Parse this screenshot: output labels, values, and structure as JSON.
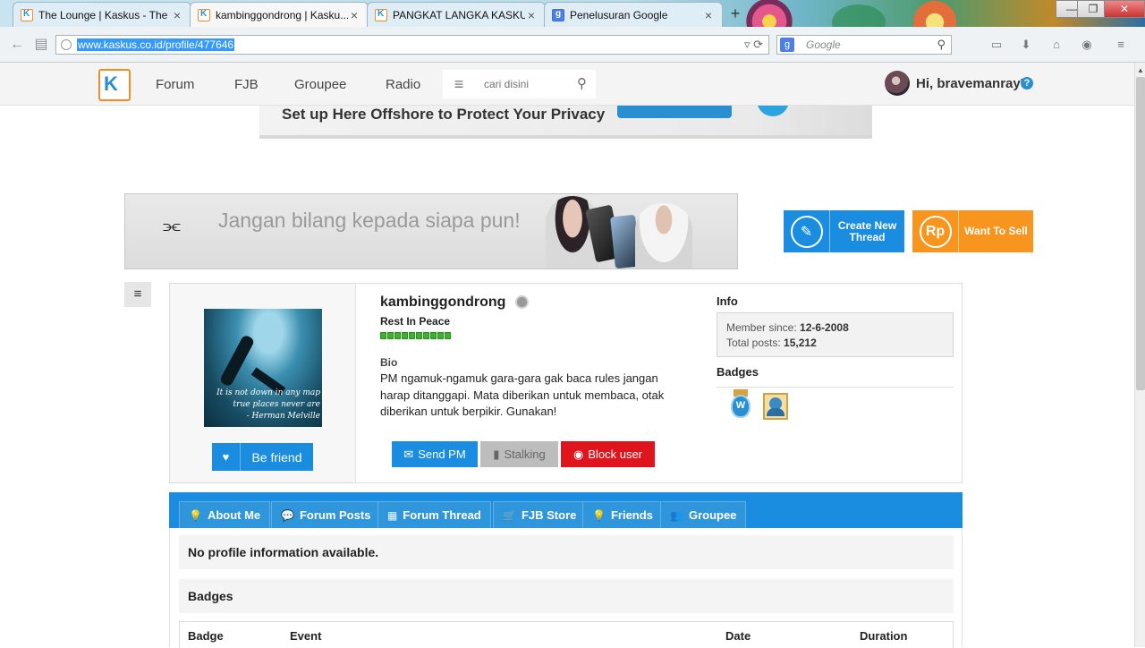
{
  "browser": {
    "tabs": [
      {
        "title": "The Lounge | Kaskus - The ...",
        "favicon": "kaskus"
      },
      {
        "title": "kambinggondrong | Kasku...",
        "favicon": "kaskus"
      },
      {
        "title": "PANGKAT LANGKA KASKU...",
        "favicon": "kaskus"
      },
      {
        "title": "Penelusuran Google",
        "favicon": "google"
      }
    ],
    "url": "www.kaskus.co.id/profile/477646",
    "search_placeholder": "Google",
    "new_tab_symbol": "+",
    "window_controls": {
      "minimize": "—",
      "maximize": "❐",
      "close": "✕"
    }
  },
  "kaskus_nav": {
    "logo": "K",
    "items": [
      "Forum",
      "FJB",
      "Groupee",
      "Radio"
    ],
    "search_placeholder": "cari disini",
    "greeting": "Hi, bravemanray7",
    "help": "?"
  },
  "ads": {
    "top_banner_text": "Set up Here Offshore to Protect Your Privacy",
    "mid_banner_text": "Jangan bilang kepada siapa pun!"
  },
  "actions": {
    "create_thread": "Create New Thread",
    "want_to_sell": "Want To Sell",
    "sell_icon_text": "Rp"
  },
  "profile": {
    "username": "kambinggondrong",
    "rank": "Rest In Peace",
    "reputation_boxes": 10,
    "bio_label": "Bio",
    "bio": "PM ngamuk-ngamuk gara-gara gak baca rules jangan harap ditanggapi. Mata diberikan untuk membaca, otak diberikan untuk berpikir. Gunakan!",
    "avatar_quote": [
      "It is not down in any map",
      "true places never are",
      "- Herman Melville"
    ],
    "befriend": "Be friend",
    "send_pm": "Send PM",
    "stalking": "Stalking",
    "block_user": "Block user",
    "info_label": "Info",
    "member_since_label": "Member since:",
    "member_since": "12-6-2008",
    "total_posts_label": "Total posts:",
    "total_posts": "15,212",
    "badges_label": "Badges",
    "badge_1_text": "W"
  },
  "profile_tabs": [
    "About Me",
    "Forum Posts",
    "Forum Thread",
    "FJB Store",
    "Friends",
    "Groupee"
  ],
  "content": {
    "no_profile": "No profile information available.",
    "badges_heading": "Badges",
    "table_columns": [
      "Badge",
      "Event",
      "Date",
      "Duration"
    ]
  },
  "colors": {
    "kaskus_blue": "#1a8de0",
    "kaskus_orange": "#f7951e",
    "block_red": "#e0141c",
    "rep_green": "#3cb22e"
  }
}
